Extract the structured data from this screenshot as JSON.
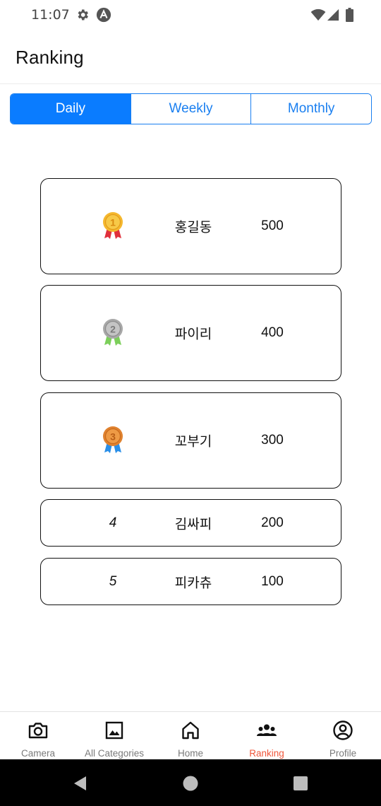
{
  "status_bar": {
    "time": "11:07"
  },
  "header": {
    "title": "Ranking"
  },
  "tabs": [
    {
      "label": "Daily",
      "active": true
    },
    {
      "label": "Weekly",
      "active": false
    },
    {
      "label": "Monthly",
      "active": false
    }
  ],
  "rankings": [
    {
      "rank": 1,
      "medal": "gold-medal-icon",
      "name": "홍길동",
      "score": "500"
    },
    {
      "rank": 2,
      "medal": "silver-medal-icon",
      "name": "파이리",
      "score": "400"
    },
    {
      "rank": 3,
      "medal": "bronze-medal-icon",
      "name": "꼬부기",
      "score": "300"
    },
    {
      "rank_label": "4",
      "name": "김싸피",
      "score": "200"
    },
    {
      "rank_label": "5",
      "name": "피카츄",
      "score": "100"
    }
  ],
  "bottom_nav": [
    {
      "label": "Camera",
      "icon": "camera-icon",
      "active": false
    },
    {
      "label": "All Categories",
      "icon": "image-icon",
      "active": false
    },
    {
      "label": "Home",
      "icon": "home-icon",
      "active": false
    },
    {
      "label": "Ranking",
      "icon": "group-icon",
      "active": true
    },
    {
      "label": "Profile",
      "icon": "profile-icon",
      "active": false
    }
  ],
  "colors": {
    "accent": "#0a7cff",
    "active_nav": "#f0563a",
    "gold": "#f5b82e",
    "silver": "#a8a8a8",
    "bronze": "#e0822f"
  }
}
